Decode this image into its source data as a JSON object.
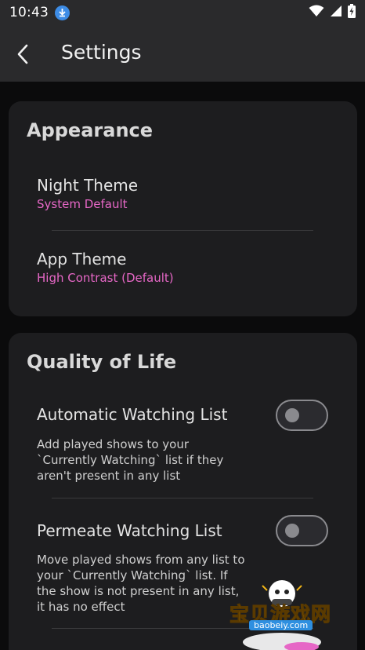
{
  "status_bar": {
    "time": "10:43"
  },
  "header": {
    "title": "Settings"
  },
  "appearance": {
    "title": "Appearance",
    "night_theme": {
      "label": "Night Theme",
      "value": "System Default"
    },
    "app_theme": {
      "label": "App Theme",
      "value": "High Contrast (Default)"
    }
  },
  "quality_of_life": {
    "title": "Quality of Life",
    "automatic_watching_list": {
      "label": "Automatic Watching List",
      "description": "Add played shows to your `Currently Watching` list if they aren't present in any list",
      "enabled": false
    },
    "permeate_watching_list": {
      "label": "Permeate Watching List",
      "description": "Move played shows from any list to your `Currently Watching` list. If the show is not present in any list, it has no effect",
      "enabled": false
    }
  },
  "watermark": {
    "text": "宝贝游戏网",
    "url": "baobeiy.com"
  },
  "colors": {
    "accent": "#e667c6",
    "card": "#1d1d1f",
    "background": "#0b0b0c",
    "bar": "#2a2a2c"
  }
}
